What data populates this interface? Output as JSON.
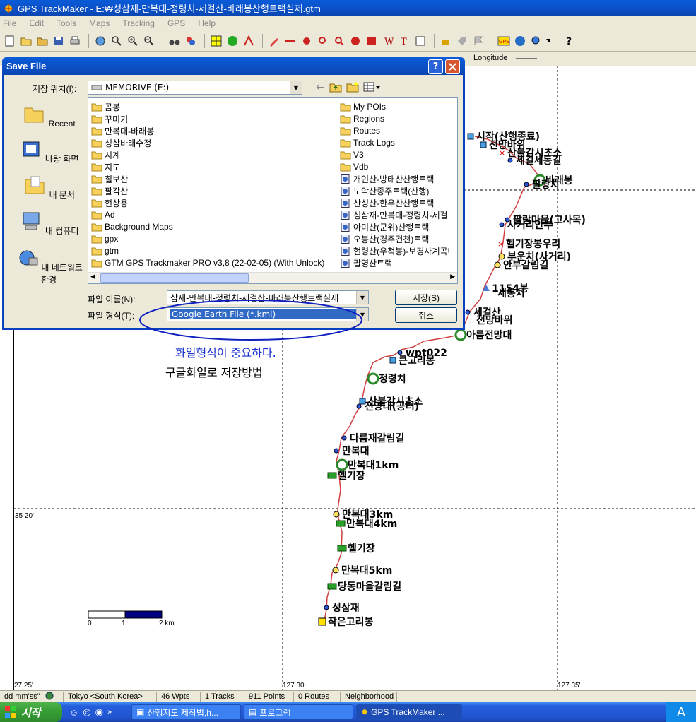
{
  "window": {
    "title": "GPS TrackMaker - E:₩성삼재-만복대-정령치-세걸산-바래봉산행트랙실제.gtm"
  },
  "menu": [
    "File",
    "Edit",
    "Tools",
    "Maps",
    "Tracking",
    "GPS",
    "Help"
  ],
  "coordbar": {
    "longitude_label": "Longitude"
  },
  "dialog": {
    "title": "Save File",
    "save_in_label": "저장 위치(I):",
    "save_in_value": "MEMORIVE (E:)",
    "places": [
      "Recent",
      "바탕 화면",
      "내 문서",
      "내 컴퓨터",
      "내 네트워크 환경"
    ],
    "files_col1": [
      "곰봉",
      "꾸미기",
      "만복대-바래봉",
      "성삼바래수정",
      "시계",
      "지도",
      "칠보산",
      "팔각산",
      "현상용",
      "Ad",
      "Background Maps",
      "gpx",
      "gtm",
      "GTM GPS Trackmaker PRO v3,8 (22-02-05) (With Unlock)"
    ],
    "files_col2_folders": [
      "My POIs",
      "Regions",
      "Routes",
      "Track Logs",
      "V3",
      "Vdb"
    ],
    "files_col2_files": [
      "개인산-방태산산행트랙",
      "노악산종주트랙(산행)",
      "산성산-한우산산행트랙",
      "성삼재-만복대-정령치-세걸",
      "아미산(군위)산행트랙",
      "오봉산(경주건천)트랙",
      "현령산(우척봉)-보경사계곡!",
      "팔영산트랙"
    ],
    "filename_label": "파일 이름(N):",
    "filename_value": "삼재-만복대-정령치-세걸산-바래봉산행트랙실제",
    "filetype_label": "파일 형식(T):",
    "filetype_value": "Google Earth File (*.kml)",
    "save_button": "저장(S)",
    "cancel_button": "취소"
  },
  "annotations": {
    "note1": "화일형식이 중요하다.",
    "note2": "구글화일로 저장방법"
  },
  "map": {
    "lat_label": "35 20'",
    "lon_labels": [
      "27 25'",
      "127 30'",
      "127 35'"
    ],
    "scale": {
      "start": "0",
      "mid": "1",
      "end": "2 km"
    },
    "waypoints": [
      "시작(산행종료)",
      "전망바위",
      "산불감시초소",
      "세걸세동길",
      "바래봉",
      "팔랑치",
      "팔랑마을(고사목)",
      "사거리안부",
      "헬기장봉우리",
      "부운치(사거리)",
      "안부갈림길",
      "1154봉",
      "세동치",
      "세걸산",
      "전망바위",
      "아름전망대",
      "wpt022",
      "큰고리봉",
      "정령치",
      "산불감시초소",
      "전망대(공터)",
      "다름재갈림길",
      "만복대",
      "만복대1km",
      "헬기장",
      "만복대3km",
      "만복대4km",
      "헬기장",
      "만복대5km",
      "당동마을갈림길",
      "성삼재",
      "작은고리봉"
    ]
  },
  "statusbar": [
    "dd mm'ss\"",
    "Tokyo <South Korea>",
    "46 Wpts",
    "1 Tracks",
    "911 Points",
    "0 Routes",
    "Neighborhood"
  ],
  "taskbar": {
    "start": "시작",
    "tasks": [
      "산행지도 제작법,h...",
      "프로그램",
      "GPS TrackMaker ..."
    ],
    "tray": "A"
  }
}
